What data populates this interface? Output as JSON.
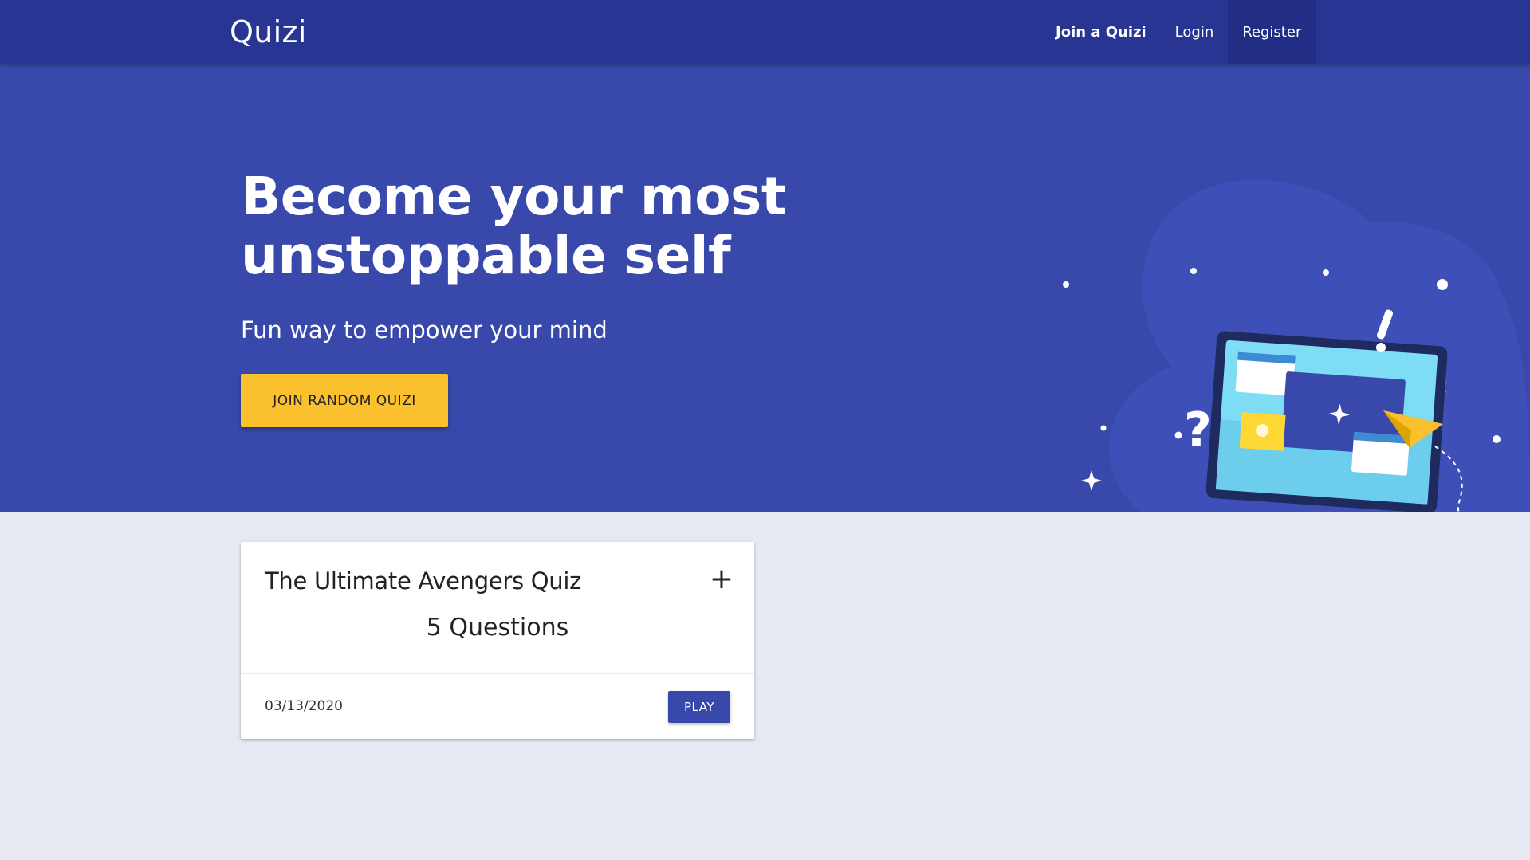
{
  "navbar": {
    "brand": "Quizi",
    "links": [
      {
        "label": "Join a Quizi"
      },
      {
        "label": "Login"
      },
      {
        "label": "Register"
      }
    ]
  },
  "hero": {
    "title_line1": "Become your most",
    "title_line2": "unstoppable self",
    "subtitle": "Fun way to empower your mind",
    "cta_label": "JOIN RANDOM QUIZI"
  },
  "quiz_cards": [
    {
      "title": "The Ultimate Avengers Quiz",
      "count": "5 Questions",
      "date": "03/13/2020",
      "play_label": "PLAY",
      "add_icon": "plus-icon"
    }
  ],
  "colors": {
    "navbar": "#283593",
    "hero": "#3949ab",
    "accent": "#fbc02d",
    "page_bg": "#e6e9f1",
    "play_button": "#3949ab"
  },
  "icons": {
    "illustration": "laptop-quiz-illustration"
  }
}
